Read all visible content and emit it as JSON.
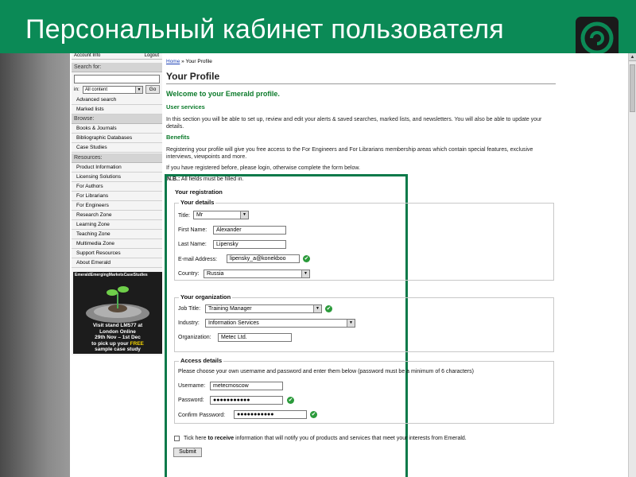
{
  "slide": {
    "title": "Персональный кабинет пользователя"
  },
  "sidebar": {
    "account_info": "Account Info",
    "logout": "Logout",
    "search_header": "Search for:",
    "in_label": "in:",
    "in_select_value": "All content",
    "go_label": "Go",
    "search_links": [
      "Advanced search",
      "Marked lists"
    ],
    "browse_header": "Browse:",
    "browse_links": [
      "Books & Journals",
      "Bibliographic Databases",
      "Case Studies"
    ],
    "resources_header": "Resources:",
    "resource_links": [
      "Product Information",
      "Licensing Solutions",
      "For Authors",
      "For Librarians",
      "For Engineers",
      "Research Zone",
      "Learning Zone",
      "Teaching Zone",
      "Multimedia Zone",
      "Support Resources",
      "About Emerald"
    ],
    "promo": {
      "brand": "EmeraldEmergingMarketsCaseStudies",
      "line1": "Visit stand LM577 at",
      "line2": "London Online",
      "line3": "29th Nov – 1st Dec",
      "line4_a": "to pick up your ",
      "line4_b": "FREE",
      "line5": "sample case study"
    }
  },
  "content": {
    "breadcrumb_home": "Home",
    "breadcrumb_rest": " » Your Profile",
    "title": "Your Profile",
    "welcome": "Welcome to your Emerald profile.",
    "user_services_head": "User services",
    "user_services_text": "In this section you will be able to set up, review and edit your alerts & saved searches, marked lists, and newsletters. You will also be able to update your details.",
    "benefits_head": "Benefits",
    "benefits_text": "Registering your profile will give you free access to the For Engineers and For Librarians membership areas which contain special features, exclusive interviews, viewpoints and more.",
    "login_text": "If you have registered before, please login, otherwise complete the form below."
  },
  "form": {
    "nb_label": "N.B.:",
    "nb_text": " All fields must be filled in.",
    "registration_legend": "Your registration",
    "details_legend": "Your details",
    "title_label": "Title:",
    "title_value": "Mr",
    "first_name_label": "First Name:",
    "first_name_value": "Alexander",
    "last_name_label": "Last Name:",
    "last_name_value": "Lipensky",
    "email_label": "E-mail Address:",
    "email_value": "lipensky_a@konekboo",
    "country_label": "Country:",
    "country_value": "Russia",
    "org_legend": "Your organization",
    "job_title_label": "Job Title:",
    "job_title_value": "Training Manager",
    "industry_label": "Industry:",
    "industry_value": "Information Services",
    "organization_label": "Organization:",
    "organization_value": "Metec Ltd.",
    "access_legend": "Access details",
    "access_text": "Please choose your own username and password and enter them below (password must be a minimum of 6 characters)",
    "username_label": "Username:",
    "username_value": "metecmoscow",
    "password_label": "Password:",
    "password_value": "●●●●●●●●●●●",
    "confirm_label": "Confirm Password:",
    "confirm_value": "●●●●●●●●●●●",
    "tick_text_a": "Tick here ",
    "tick_text_b": "to receive",
    "tick_text_c": " information that will notify you of products and services that meet your interests from Emerald.",
    "submit_label": "Submit"
  },
  "icons": {
    "check": "✔",
    "arrow": "▼",
    "scroll_up": "▲"
  },
  "colors": {
    "banner": "#0b8a56",
    "heading_green": "#0b7a2a",
    "check_green": "#2a9a3a"
  }
}
